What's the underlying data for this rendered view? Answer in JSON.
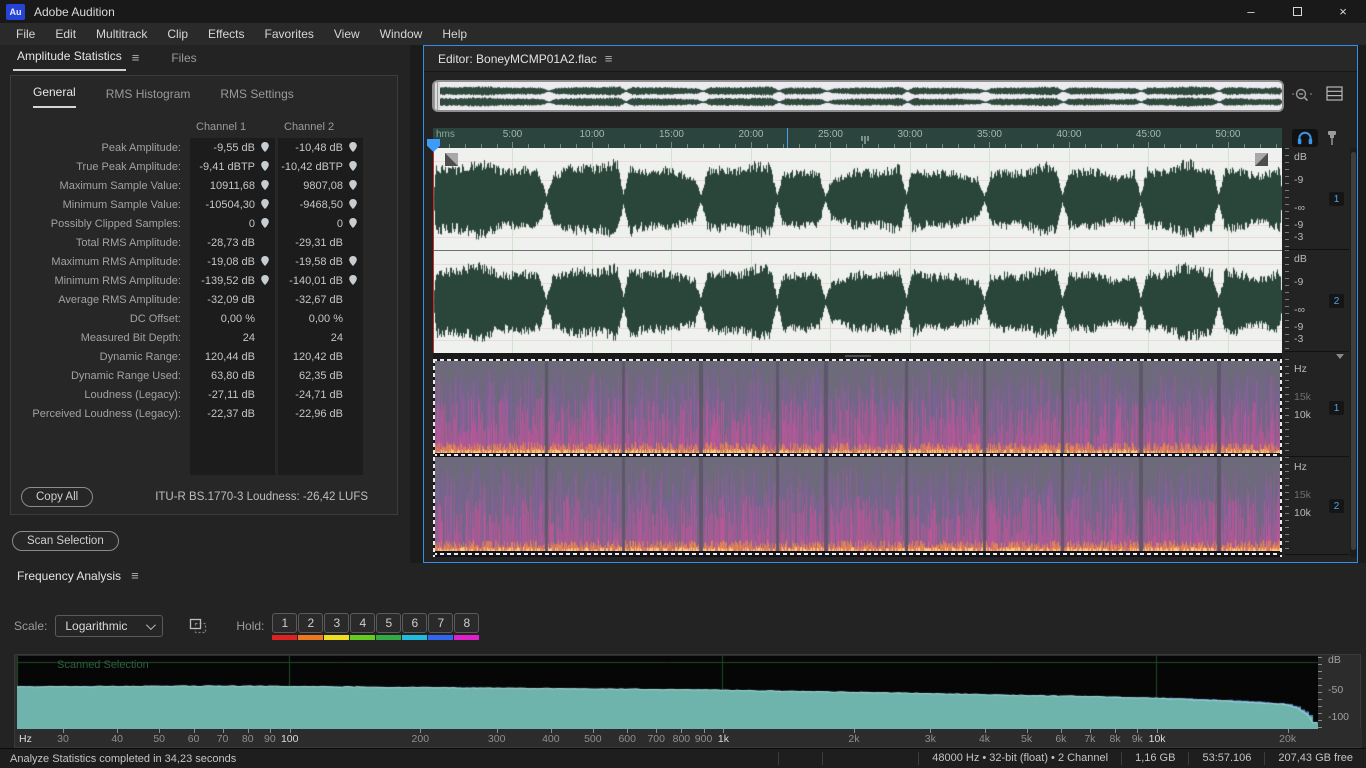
{
  "window": {
    "app_badge": "Au",
    "title": "Adobe Audition"
  },
  "icons": {
    "panel_menu": "≡",
    "minimize": "–",
    "maximize": "maximize-box",
    "close": "×",
    "bullet": "•"
  },
  "menu": {
    "items": [
      "File",
      "Edit",
      "Multitrack",
      "Clip",
      "Effects",
      "Favorites",
      "View",
      "Window",
      "Help"
    ]
  },
  "stats_panel": {
    "tabs": [
      {
        "label": "Amplitude Statistics",
        "active": true
      },
      {
        "label": "Files",
        "active": false
      }
    ],
    "sub_tabs": [
      {
        "label": "General",
        "active": true
      },
      {
        "label": "RMS Histogram",
        "active": false
      },
      {
        "label": "RMS Settings",
        "active": false
      }
    ],
    "columns": [
      "Channel 1",
      "Channel 2"
    ],
    "rows": [
      {
        "label": "Peak Amplitude:",
        "ch1": "-9,55 dB",
        "ch2": "-10,48 dB",
        "pin": true
      },
      {
        "label": "True Peak Amplitude:",
        "ch1": "-9,41 dBTP",
        "ch2": "-10,42 dBTP",
        "pin": true
      },
      {
        "label": "Maximum Sample Value:",
        "ch1": "10911,68",
        "ch2": "9807,08",
        "pin": true
      },
      {
        "label": "Minimum Sample Value:",
        "ch1": "-10504,30",
        "ch2": "-9468,50",
        "pin": true
      },
      {
        "label": "Possibly Clipped Samples:",
        "ch1": "0",
        "ch2": "0",
        "pin": true
      },
      {
        "label": "Total RMS Amplitude:",
        "ch1": "-28,73 dB",
        "ch2": "-29,31 dB",
        "pin": false
      },
      {
        "label": "Maximum RMS Amplitude:",
        "ch1": "-19,08 dB",
        "ch2": "-19,58 dB",
        "pin": true
      },
      {
        "label": "Minimum RMS Amplitude:",
        "ch1": "-139,52 dB",
        "ch2": "-140,01 dB",
        "pin": true
      },
      {
        "label": "Average RMS Amplitude:",
        "ch1": "-32,09 dB",
        "ch2": "-32,67 dB",
        "pin": false
      },
      {
        "label": "DC Offset:",
        "ch1": "0,00 %",
        "ch2": "0,00 %",
        "pin": false
      },
      {
        "label": "Measured Bit Depth:",
        "ch1": "24",
        "ch2": "24",
        "pin": false
      },
      {
        "label": "Dynamic Range:",
        "ch1": "120,44 dB",
        "ch2": "120,42 dB",
        "pin": false
      },
      {
        "label": "Dynamic Range Used:",
        "ch1": "63,80 dB",
        "ch2": "62,35 dB",
        "pin": false
      },
      {
        "label": "Loudness (Legacy):",
        "ch1": "-27,11 dB",
        "ch2": "-24,71 dB",
        "pin": false
      },
      {
        "label": "Perceived Loudness (Legacy):",
        "ch1": "-22,37 dB",
        "ch2": "-22,96 dB",
        "pin": false
      }
    ],
    "copy_all_label": "Copy All",
    "loudness_text": "ITU-R BS.1770-3 Loudness:  -26,42 LUFS",
    "scan_selection_label": "Scan Selection"
  },
  "editor": {
    "tab_label": "Editor: BoneyMCMP01A2.flac",
    "timeline": {
      "unit": "hms",
      "major_labels": [
        "5:00",
        "10:00",
        "15:00",
        "20:00",
        "25:00",
        "30:00",
        "35:00",
        "40:00",
        "45:00",
        "50:00"
      ]
    },
    "channels": [
      {
        "badge": "1"
      },
      {
        "badge": "2"
      }
    ],
    "amplitude_scale": {
      "ticks": [
        {
          "t": "dB",
          "p": 9
        },
        {
          "t": "-9",
          "p": 32
        },
        {
          "t": "-∞",
          "p": 59
        },
        {
          "t": "-9",
          "p": 76
        },
        {
          "t": "-3",
          "p": 88
        }
      ]
    },
    "frequency_scale": {
      "ticks": [
        {
          "t": "Hz",
          "p": 10
        },
        {
          "t": "15k",
          "p": 39,
          "dim": true
        },
        {
          "t": "10k",
          "p": 58
        }
      ]
    }
  },
  "frequency_analysis": {
    "title": "Frequency Analysis",
    "scale_label": "Scale:",
    "scale_value": "Logarithmic",
    "hold_label": "Hold:",
    "hold_buttons": [
      {
        "label": "1",
        "color": "#dd2222"
      },
      {
        "label": "2",
        "color": "#ee7722"
      },
      {
        "label": "3",
        "color": "#eedd22"
      },
      {
        "label": "4",
        "color": "#66cc22"
      },
      {
        "label": "5",
        "color": "#33aa44"
      },
      {
        "label": "6",
        "color": "#22bbdd"
      },
      {
        "label": "7",
        "color": "#3366ee"
      },
      {
        "label": "8",
        "color": "#dd22cc"
      }
    ],
    "plot_label": "Scanned Selection",
    "x_unit": "Hz",
    "x_ticks": [
      {
        "label": "30",
        "f": 30
      },
      {
        "label": "40",
        "f": 40
      },
      {
        "label": "50",
        "f": 50
      },
      {
        "label": "60",
        "f": 60
      },
      {
        "label": "70",
        "f": 70
      },
      {
        "label": "80",
        "f": 80
      },
      {
        "label": "90",
        "f": 90
      },
      {
        "label": "100",
        "f": 100,
        "bright": true
      },
      {
        "label": "200",
        "f": 200
      },
      {
        "label": "300",
        "f": 300
      },
      {
        "label": "400",
        "f": 400
      },
      {
        "label": "500",
        "f": 500
      },
      {
        "label": "600",
        "f": 600
      },
      {
        "label": "700",
        "f": 700
      },
      {
        "label": "800",
        "f": 800
      },
      {
        "label": "900",
        "f": 900
      },
      {
        "label": "1k",
        "f": 1000,
        "bright": true
      },
      {
        "label": "2k",
        "f": 2000
      },
      {
        "label": "3k",
        "f": 3000
      },
      {
        "label": "4k",
        "f": 4000
      },
      {
        "label": "5k",
        "f": 5000
      },
      {
        "label": "6k",
        "f": 6000
      },
      {
        "label": "7k",
        "f": 7000
      },
      {
        "label": "8k",
        "f": 8000
      },
      {
        "label": "9k",
        "f": 9000
      },
      {
        "label": "10k",
        "f": 10000,
        "bright": true
      },
      {
        "label": "20k",
        "f": 20000
      }
    ],
    "y_ticks": [
      {
        "label": "dB",
        "p": 7
      },
      {
        "label": "-50",
        "p": 46
      },
      {
        "label": "-100",
        "p": 83
      }
    ]
  },
  "chart_data": {
    "type": "area",
    "title": "Frequency Analysis — Scanned Selection",
    "xlabel": "Hz",
    "ylabel": "dB",
    "x_scale": "log",
    "x_range": [
      23.5,
      23500
    ],
    "y_range": [
      -110,
      0
    ],
    "legend": [
      "Channel 1",
      "Channel 2"
    ],
    "points_hz_db": [
      [
        25,
        -44
      ],
      [
        40,
        -43.5
      ],
      [
        60,
        -43
      ],
      [
        80,
        -43
      ],
      [
        100,
        -43.5
      ],
      [
        150,
        -44.5
      ],
      [
        200,
        -45.5
      ],
      [
        300,
        -46.5
      ],
      [
        400,
        -47.5
      ],
      [
        600,
        -48.5
      ],
      [
        800,
        -49.5
      ],
      [
        1000,
        -50.5
      ],
      [
        1500,
        -52.5
      ],
      [
        2000,
        -54
      ],
      [
        3000,
        -56.5
      ],
      [
        4000,
        -58.5
      ],
      [
        5000,
        -60
      ],
      [
        6000,
        -61
      ],
      [
        7000,
        -62
      ],
      [
        8000,
        -63
      ],
      [
        10000,
        -65
      ],
      [
        12000,
        -67.5
      ],
      [
        15000,
        -70.5
      ],
      [
        18000,
        -74
      ],
      [
        20000,
        -77
      ],
      [
        21000,
        -82
      ],
      [
        22000,
        -92
      ],
      [
        22800,
        -103
      ]
    ]
  },
  "status_bar": {
    "message": "Analyze Statistics completed in 34,23 seconds",
    "cells": [
      "48000 Hz • 32-bit (float) • 2 Channel",
      "1,16 GB",
      "53:57.106",
      "207,43 GB free"
    ]
  }
}
